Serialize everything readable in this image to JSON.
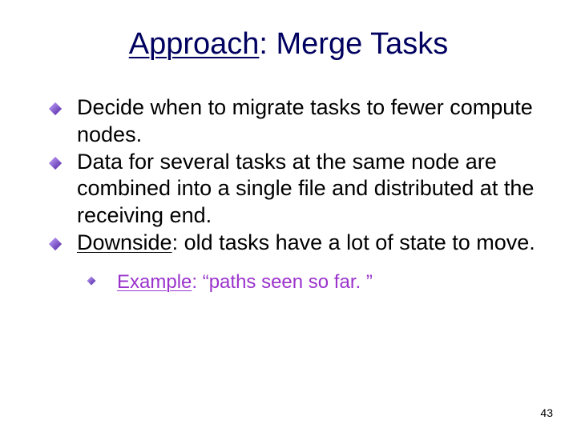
{
  "title_underlined": "Approach",
  "title_rest": ": Merge Tasks",
  "bullets": [
    {
      "text": "Decide when to migrate tasks to fewer compute nodes."
    },
    {
      "text": "Data for several tasks at the same node are combined into a single file and distributed at the receiving end."
    },
    {
      "underlined": "Downside",
      "rest": ": old tasks have a lot of state to move."
    }
  ],
  "sub_bullet": {
    "underlined": "Example",
    "rest": ": “paths seen so far. ”"
  },
  "slide_number": "43",
  "colors": {
    "title": "#000060",
    "sub": "#9a33cc",
    "diamond_start": "#c8a8ff",
    "diamond_end": "#4a1e9e"
  }
}
